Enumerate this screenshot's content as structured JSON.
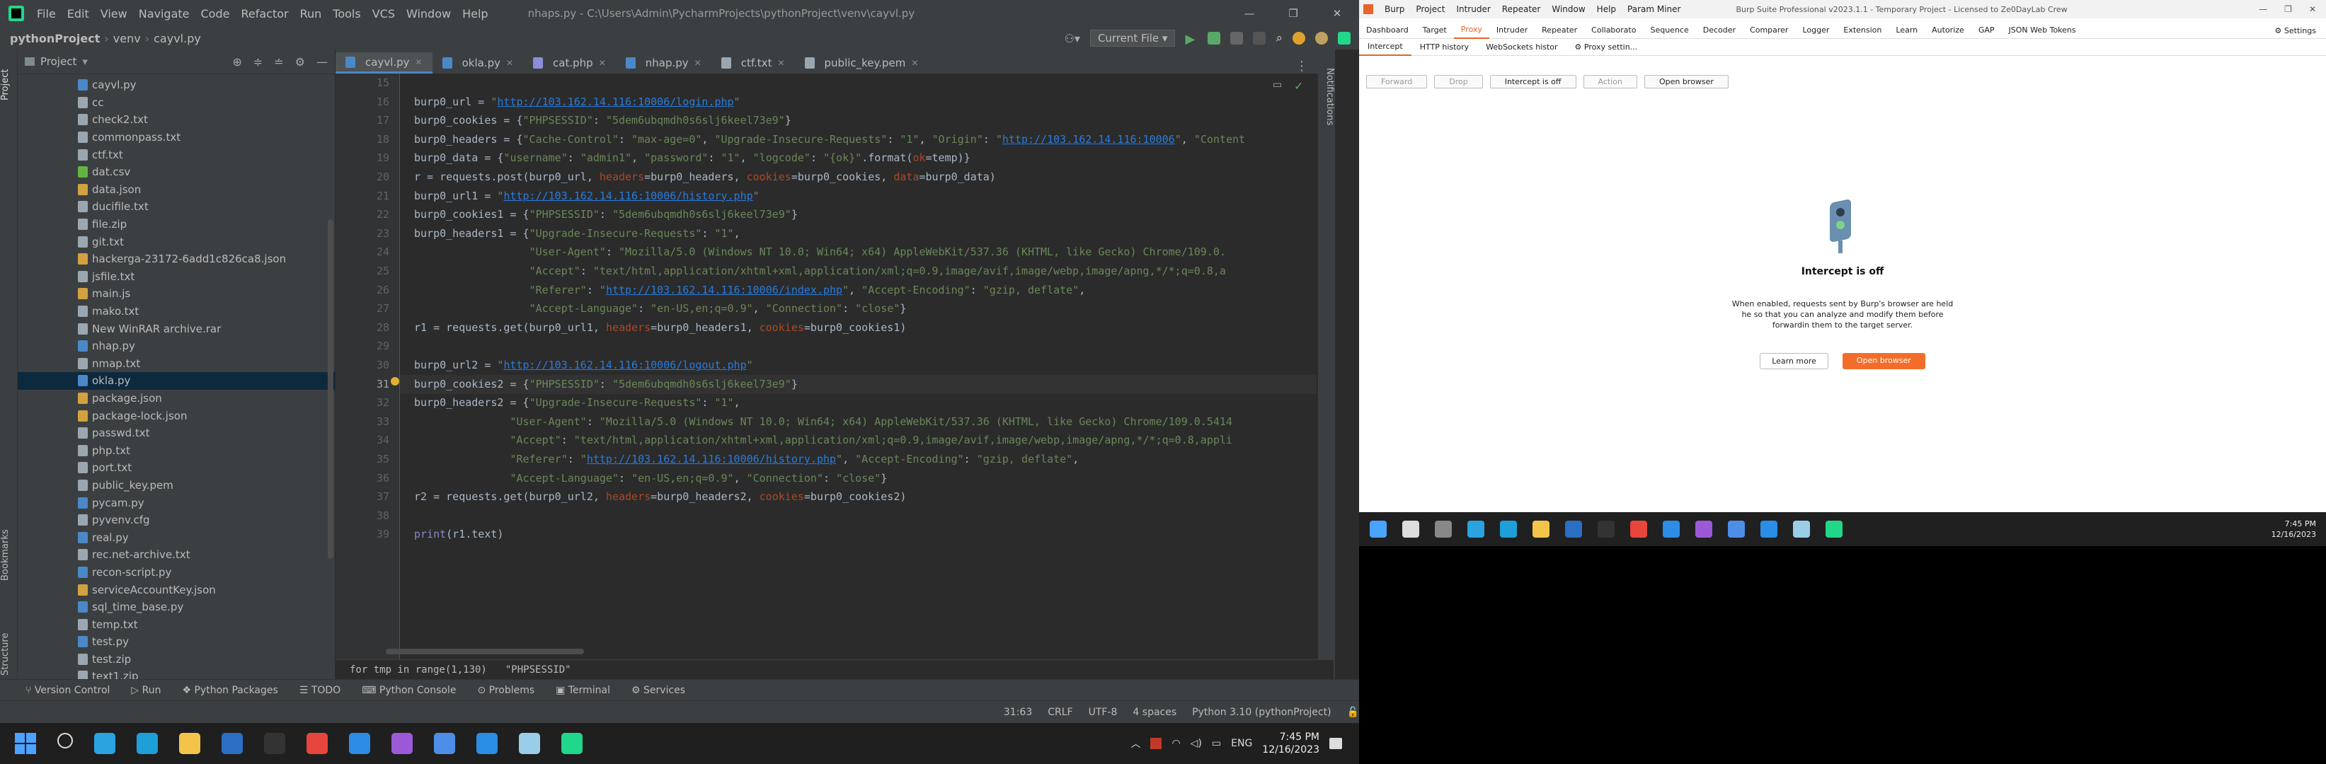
{
  "pycharm": {
    "menu": [
      "File",
      "Edit",
      "View",
      "Navigate",
      "Code",
      "Refactor",
      "Run",
      "Tools",
      "VCS",
      "Window",
      "Help"
    ],
    "window_title": "nhaps.py - C:\\Users\\Admin\\PycharmProjects\\pythonProject\\venv\\cayvl.py",
    "win_controls": [
      "—",
      "❐",
      "✕"
    ],
    "breadcrumb": [
      "pythonProject",
      "venv",
      "cayvl.py"
    ],
    "run_config": "Current File",
    "project_panel_title": "Project",
    "left_tabs": [
      "Project",
      "Bookmarks",
      "Structure"
    ],
    "right_tabs": [
      "Notifications"
    ],
    "files": [
      {
        "name": "cayvl.py",
        "color": "#4a88c7"
      },
      {
        "name": "cc",
        "color": "#9aa7b0"
      },
      {
        "name": "check2.txt",
        "color": "#9aa7b0"
      },
      {
        "name": "commonpass.txt",
        "color": "#9aa7b0"
      },
      {
        "name": "ctf.txt",
        "color": "#9aa7b0"
      },
      {
        "name": "dat.csv",
        "color": "#62b543"
      },
      {
        "name": "data.json",
        "color": "#d1a23f"
      },
      {
        "name": "ducifile.txt",
        "color": "#9aa7b0"
      },
      {
        "name": "file.zip",
        "color": "#9aa7b0"
      },
      {
        "name": "git.txt",
        "color": "#9aa7b0"
      },
      {
        "name": "hackerga-23172-6add1c826ca8.json",
        "color": "#d1a23f"
      },
      {
        "name": "jsfile.txt",
        "color": "#9aa7b0"
      },
      {
        "name": "main.js",
        "color": "#d1a23f"
      },
      {
        "name": "mako.txt",
        "color": "#9aa7b0"
      },
      {
        "name": "New WinRAR archive.rar",
        "color": "#9aa7b0"
      },
      {
        "name": "nhap.py",
        "color": "#4a88c7"
      },
      {
        "name": "nmap.txt",
        "color": "#9aa7b0"
      },
      {
        "name": "okla.py",
        "color": "#4a88c7"
      },
      {
        "name": "package.json",
        "color": "#d1a23f"
      },
      {
        "name": "package-lock.json",
        "color": "#d1a23f"
      },
      {
        "name": "passwd.txt",
        "color": "#9aa7b0"
      },
      {
        "name": "php.txt",
        "color": "#9aa7b0"
      },
      {
        "name": "port.txt",
        "color": "#9aa7b0"
      },
      {
        "name": "public_key.pem",
        "color": "#9aa7b0"
      },
      {
        "name": "pycam.py",
        "color": "#4a88c7"
      },
      {
        "name": "pyvenv.cfg",
        "color": "#9aa7b0"
      },
      {
        "name": "real.py",
        "color": "#4a88c7"
      },
      {
        "name": "rec.net-archive.txt",
        "color": "#9aa7b0"
      },
      {
        "name": "recon-script.py",
        "color": "#4a88c7"
      },
      {
        "name": "serviceAccountKey.json",
        "color": "#d1a23f"
      },
      {
        "name": "sql_time_base.py",
        "color": "#4a88c7"
      },
      {
        "name": "temp.txt",
        "color": "#9aa7b0"
      },
      {
        "name": "test.py",
        "color": "#4a88c7"
      },
      {
        "name": "test.zip",
        "color": "#9aa7b0"
      },
      {
        "name": "text1.zip",
        "color": "#9aa7b0"
      }
    ],
    "selected_file": "okla.py",
    "editor_tabs": [
      "cayvl.py",
      "okla.py",
      "cat.php",
      "nhap.py",
      "ctf.txt",
      "public_key.pem"
    ],
    "active_tab": "cayvl.py",
    "line_numbers": [
      "15",
      "16",
      "17",
      "18",
      "19",
      "20",
      "21",
      "22",
      "23",
      "24",
      "25",
      "26",
      "27",
      "28",
      "29",
      "30",
      "31",
      "32",
      "33",
      "34",
      "35",
      "36",
      "37",
      "38",
      "39"
    ],
    "current_line": "31",
    "code_lines": [
      "",
      "burp0_url = \"http://103.162.14.116:10006/login.php\"",
      "burp0_cookies = {\"PHPSESSID\": \"5dem6ubqmdh0s6slj6keel73e9\"}",
      "burp0_headers = {\"Cache-Control\": \"max-age=0\", \"Upgrade-Insecure-Requests\": \"1\", \"Origin\": \"http://103.162.14.116:10006\", \"Content",
      "burp0_data = {\"username\": \"admin1\", \"password\": \"1\", \"logcode\": \"{ok}\".format(ok=temp)}",
      "r = requests.post(burp0_url, headers=burp0_headers, cookies=burp0_cookies, data=burp0_data)",
      "burp0_url1 = \"http://103.162.14.116:10006/history.php\"",
      "burp0_cookies1 = {\"PHPSESSID\": \"5dem6ubqmdh0s6slj6keel73e9\"}",
      "burp0_headers1 = {\"Upgrade-Insecure-Requests\": \"1\",",
      "                  \"User-Agent\": \"Mozilla/5.0 (Windows NT 10.0; Win64; x64) AppleWebKit/537.36 (KHTML, like Gecko) Chrome/109.0.",
      "                  \"Accept\": \"text/html,application/xhtml+xml,application/xml;q=0.9,image/avif,image/webp,image/apng,*/*;q=0.8,a",
      "                  \"Referer\": \"http://103.162.14.116:10006/index.php\", \"Accept-Encoding\": \"gzip, deflate\",",
      "                  \"Accept-Language\": \"en-US,en;q=0.9\", \"Connection\": \"close\"}",
      "r1 = requests.get(burp0_url1, headers=burp0_headers1, cookies=burp0_cookies1)",
      "",
      "burp0_url2 = \"http://103.162.14.116:10006/logout.php\"",
      "burp0_cookies2 = {\"PHPSESSID\": \"5dem6ubqmdh0s6slj6keel73e9\"}",
      "burp0_headers2 = {\"Upgrade-Insecure-Requests\": \"1\",",
      "               \"User-Agent\": \"Mozilla/5.0 (Windows NT 10.0; Win64; x64) AppleWebKit/537.36 (KHTML, like Gecko) Chrome/109.0.5414",
      "               \"Accept\": \"text/html,application/xhtml+xml,application/xml;q=0.9,image/avif,image/webp,image/apng,*/*;q=0.8,appli",
      "               \"Referer\": \"http://103.162.14.116:10006/history.php\", \"Accept-Encoding\": \"gzip, deflate\",",
      "               \"Accept-Language\": \"en-US,en;q=0.9\", \"Connection\": \"close\"}",
      "r2 = requests.get(burp0_url2, headers=burp0_headers2, cookies=burp0_cookies2)",
      "",
      "print(r1.text)"
    ],
    "code_breadcrumb": [
      "for tmp in range(1,130)",
      "\"PHPSESSID\""
    ],
    "bottom_tools": [
      "Version Control",
      "Run",
      "Python Packages",
      "TODO",
      "Python Console",
      "Problems",
      "Terminal",
      "Services"
    ],
    "status": [
      "31:63",
      "CRLF",
      "UTF-8",
      "4 spaces",
      "Python 3.10 (pythonProject)"
    ],
    "taskbar": {
      "icons": [
        "windows-start",
        "search",
        "telegram",
        "edge",
        "explorer",
        "powershell",
        "terminal",
        "chrome",
        "vscode",
        "visual-studio",
        "chrome-alt",
        "messenger",
        "notepad",
        "pycharm"
      ],
      "icon_colors": [
        "#4aa3ff",
        "#ddd",
        "#2aa3e0",
        "#1e9fd8",
        "#f4c44a",
        "#2a6fc4",
        "#333",
        "#e8453c",
        "#2c8ce6",
        "#9b59d9",
        "#4d8fe8",
        "#2a8de6",
        "#9acde8",
        "#21d789"
      ],
      "lang": "ENG",
      "time": "7:45 PM",
      "date": "12/16/2023"
    }
  },
  "burp": {
    "menu": [
      "Burp",
      "Project",
      "Intruder",
      "Repeater",
      "Window",
      "Help",
      "Param Miner"
    ],
    "title": "Burp Suite Professional v2023.1.1 - Temporary Project - Licensed to Ze0DayLab Crew",
    "tabs": [
      "Dashboard",
      "Target",
      "Proxy",
      "Intruder",
      "Repeater",
      "Collaborato",
      "Sequence",
      "Decoder",
      "Comparer",
      "Logger",
      "Extension",
      "Learn",
      "Autorize",
      "GAP",
      "JSON Web Tokens"
    ],
    "active_tab": "Proxy",
    "settings_label": "Settings",
    "proxy_tabs": [
      "Intercept",
      "HTTP history",
      "WebSockets histor"
    ],
    "proxy_settings": "Proxy settin...",
    "actions": [
      "Forward",
      "Drop",
      "Intercept is off",
      "Action",
      "Open browser"
    ],
    "intercept_title": "Intercept is off",
    "intercept_desc": "When enabled, requests sent by Burp's browser are held he so that you can analyze and modify them before forwardin them to the target server.",
    "learn_more": "Learn more",
    "open_browser": "Open browser",
    "taskbar": {
      "icon_colors": [
        "#4aa3ff",
        "#ddd",
        "#888",
        "#2aa3e0",
        "#1e9fd8",
        "#f4c44a",
        "#2a6fc4",
        "#333",
        "#e8453c",
        "#2c8ce6",
        "#9b59d9",
        "#4d8fe8",
        "#2a8de6",
        "#9acde8",
        "#21d789"
      ],
      "time": "7:45 PM",
      "date": "12/16/2023"
    }
  }
}
